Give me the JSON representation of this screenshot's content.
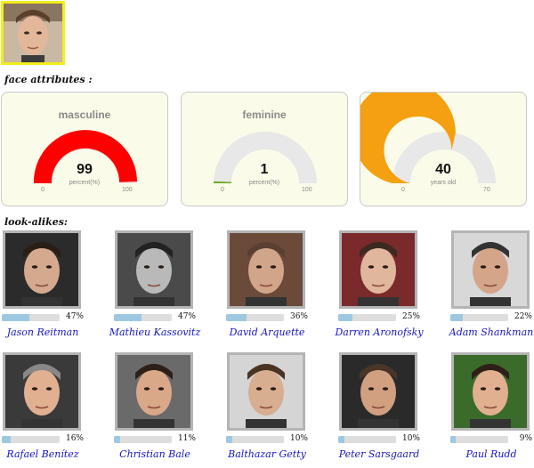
{
  "query": {
    "alt": "query face"
  },
  "sections": {
    "face_attributes": "face attributes :",
    "look_alikes": "look-alikes:"
  },
  "gauges": [
    {
      "label": "masculine",
      "value": "99",
      "unit": "percent(%)",
      "min": "0",
      "max": "100",
      "fraction": 0.99,
      "color": "#ff0000"
    },
    {
      "label": "feminine",
      "value": "1",
      "unit": "percent(%)",
      "min": "0",
      "max": "100",
      "fraction": 0.01,
      "color": "#66aa22"
    },
    {
      "label": "age",
      "value": "40",
      "unit": "years old",
      "min": "0",
      "max": "70",
      "fraction": 0.5714,
      "color": "#f5a010"
    }
  ],
  "look_alikes": [
    {
      "name": "Jason Reitman",
      "percent": "47%",
      "fraction": 0.47
    },
    {
      "name": "Mathieu Kassovitz",
      "percent": "47%",
      "fraction": 0.47
    },
    {
      "name": "David Arquette",
      "percent": "36%",
      "fraction": 0.36
    },
    {
      "name": "Darren Aronofsky",
      "percent": "25%",
      "fraction": 0.25
    },
    {
      "name": "Adam Shankman",
      "percent": "22%",
      "fraction": 0.22
    },
    {
      "name": "Rafael Benítez",
      "percent": "16%",
      "fraction": 0.16
    },
    {
      "name": "Christian Bale",
      "percent": "11%",
      "fraction": 0.11
    },
    {
      "name": "Balthazar Getty",
      "percent": "10%",
      "fraction": 0.1
    },
    {
      "name": "Peter Sarsgaard",
      "percent": "10%",
      "fraction": 0.1
    },
    {
      "name": "Paul Rudd",
      "percent": "9%",
      "fraction": 0.09
    }
  ],
  "colors": {
    "query_border": "#f3ee1a",
    "card_bg": "#fbfbe9",
    "gauge_track": "#e8e8e8",
    "bar_fill": "#9ec8e0",
    "bar_track": "#dedede",
    "name_link": "#1515c8"
  }
}
